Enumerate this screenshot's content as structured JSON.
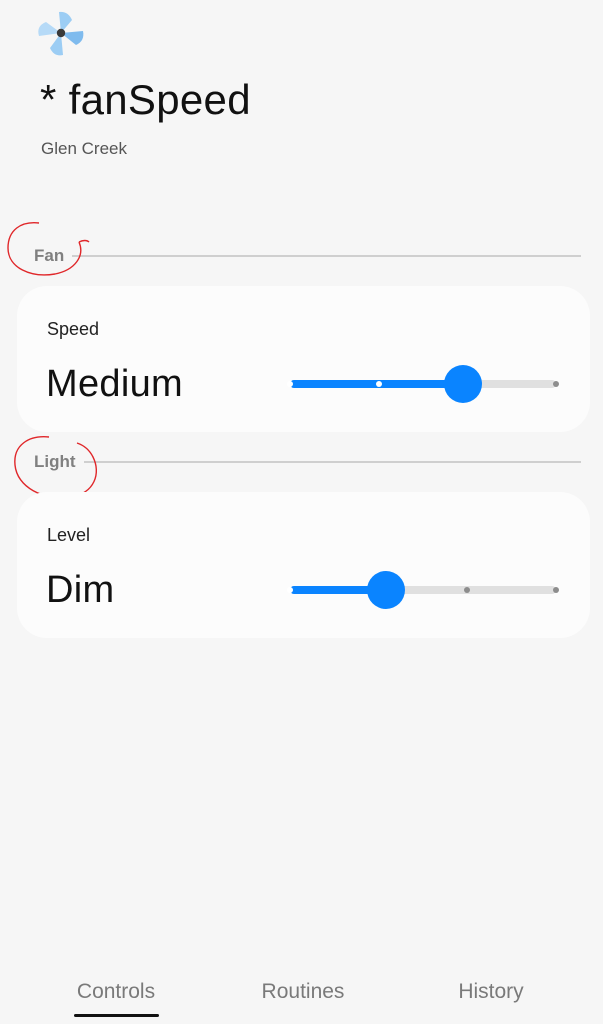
{
  "device": {
    "title": "* fanSpeed",
    "location": "Glen Creek",
    "icon": "pinwheel-fan-icon"
  },
  "sections": [
    {
      "header": "Fan",
      "control_label": "Speed",
      "value": "Medium",
      "slider": {
        "steps": 4,
        "selected_step": 3,
        "fill_fraction": 0.65
      }
    },
    {
      "header": "Light",
      "control_label": "Level",
      "value": "Dim",
      "slider": {
        "steps": 4,
        "selected_step": 2,
        "fill_fraction": 0.36
      }
    }
  ],
  "nav": {
    "tabs": [
      "Controls",
      "Routines",
      "History"
    ],
    "active_index": 0
  },
  "colors": {
    "accent": "#0a84ff",
    "annotation": "#e0272a",
    "background": "#f6f6f6",
    "card": "#fcfcfc"
  }
}
